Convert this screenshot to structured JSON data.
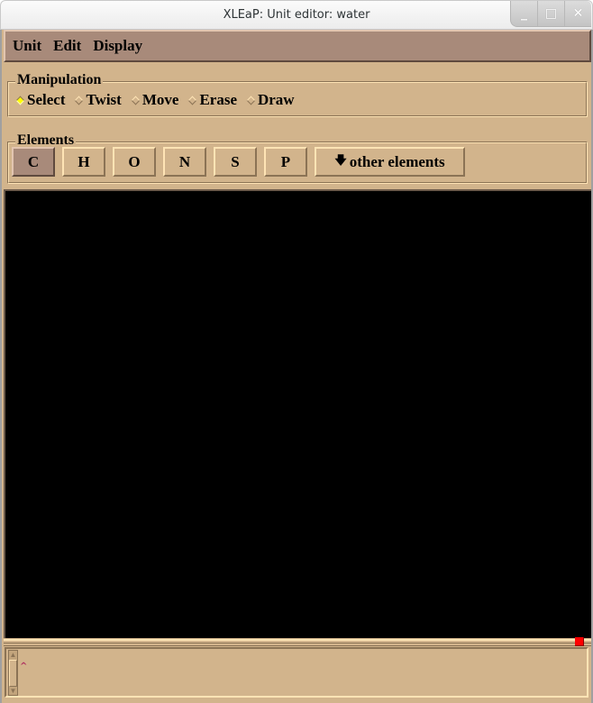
{
  "window": {
    "title": "XLEaP: Unit editor: water",
    "controls": {
      "minimize": "_",
      "maximize": "□",
      "close": "✕"
    }
  },
  "menubar": {
    "items": [
      {
        "label": "Unit"
      },
      {
        "label": "Edit"
      },
      {
        "label": "Display"
      }
    ]
  },
  "manipulation": {
    "legend": "Manipulation",
    "options": [
      {
        "label": "Select",
        "selected": true
      },
      {
        "label": "Twist",
        "selected": false
      },
      {
        "label": "Move",
        "selected": false
      },
      {
        "label": "Erase",
        "selected": false
      },
      {
        "label": "Draw",
        "selected": false
      }
    ],
    "selected_color": "#ffff00"
  },
  "elements": {
    "legend": "Elements",
    "buttons": [
      {
        "label": "C",
        "active": true
      },
      {
        "label": "H",
        "active": false
      },
      {
        "label": "O",
        "active": false
      },
      {
        "label": "N",
        "active": false
      },
      {
        "label": "S",
        "active": false
      },
      {
        "label": "P",
        "active": false
      }
    ],
    "other": {
      "icon": "down-arrow-icon",
      "arrow": "🡇",
      "label": "other elements"
    }
  },
  "canvas": {
    "background": "#000000"
  },
  "status": {
    "indicator_color": "#ff0000"
  },
  "log": {
    "caret": "^",
    "scroll_up": "▲",
    "scroll_down": "▼"
  },
  "colors": {
    "panel": "#d2b48c",
    "menubar": "#a88a7a"
  }
}
